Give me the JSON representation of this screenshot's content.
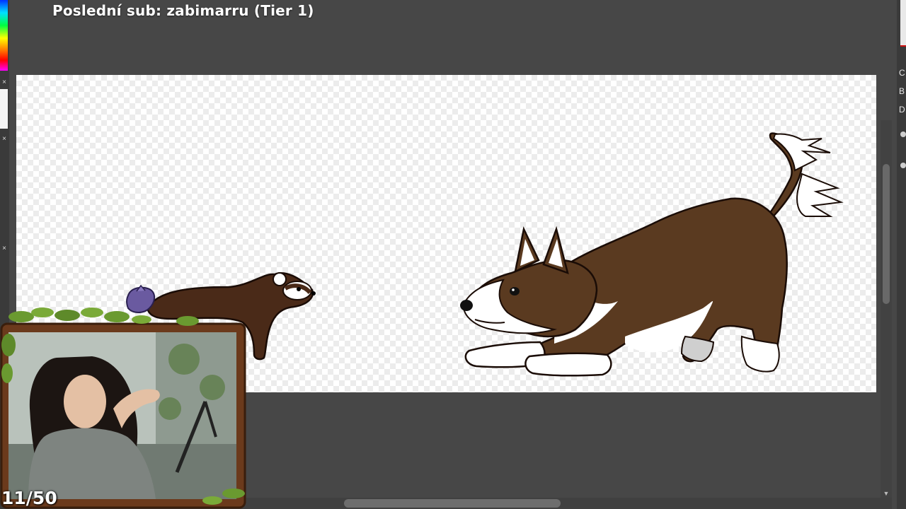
{
  "overlay": {
    "last_sub_text": "Poslední sub: zabimarru (Tier 1)",
    "counter_text": "11/50"
  },
  "right_panel": {
    "labels": [
      "C",
      "B",
      "D"
    ]
  },
  "scrollbar": {
    "up_arrow": "▲",
    "down_arrow": "▼"
  },
  "icons": {
    "close": "×"
  },
  "colors": {
    "background": "#474747",
    "dog_brown": "#5a3a20",
    "ferret_brown": "#4a2a18",
    "bird_purple": "#6a5aa0",
    "frame_wood": "#6b3a1c",
    "leaf_green": "#6a9a30"
  }
}
